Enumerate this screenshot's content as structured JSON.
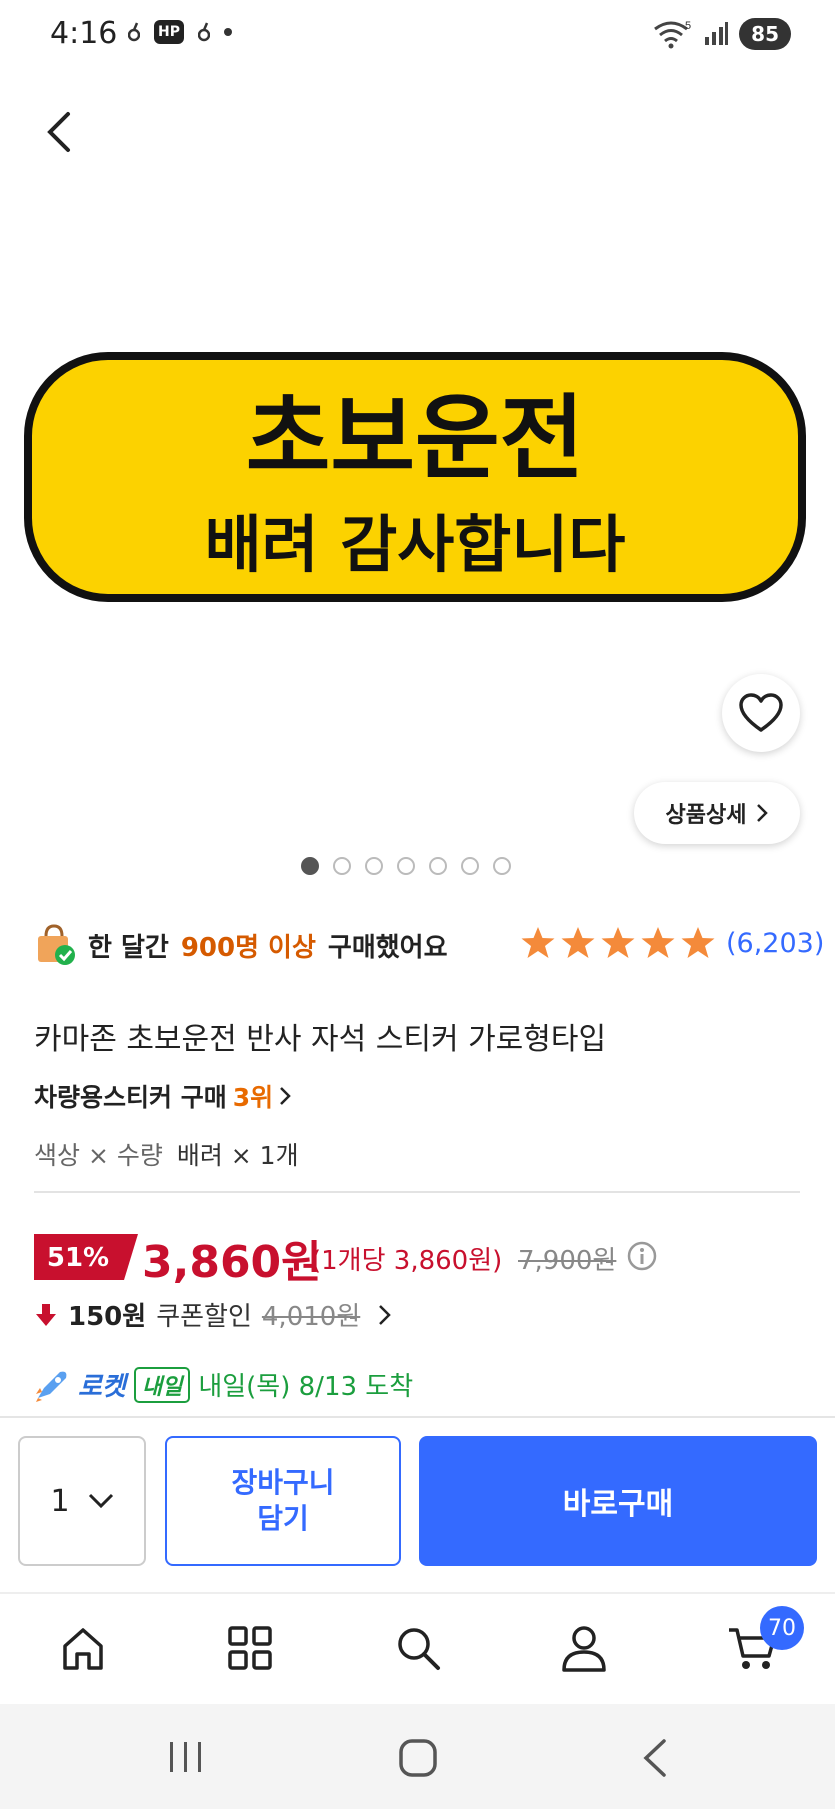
{
  "status_bar": {
    "time": "4:16",
    "hp_badge": "HP",
    "battery": "85",
    "wifi_label": "5"
  },
  "product": {
    "image_sticker_line1": "초보운전",
    "image_sticker_line2": "배려 감사합니다",
    "image_colors": {
      "fill": "#fcd200",
      "border": "#111111"
    },
    "detail_button": "상품상세",
    "image_count": 7,
    "current_image_index": 0,
    "purchase_text_prefix": "한 달간",
    "purchase_count": "900명 이상",
    "purchase_text_suffix": "구매했어요",
    "rating_stars": 5,
    "rating_count": "(6,203)",
    "title": "카마존 초보운전 반사 자석 스티커 가로형타입",
    "rank_text": "차량용스티커 구매",
    "rank_value": "3위",
    "option_label": "색상 × 수량",
    "option_value": "배려 × 1개"
  },
  "price": {
    "discount": "51%",
    "sale_price": "3,860원",
    "unit_price": "(1개당 3,860원)",
    "original_price": "7,900원",
    "coupon_amount": "150원",
    "coupon_label": "쿠폰할인",
    "pre_coupon_price": "4,010원"
  },
  "delivery": {
    "rocket_label": "로켓",
    "tomorrow_badge": "내일",
    "arrival": "내일(목) 8/13 도착"
  },
  "actions": {
    "quantity": "1",
    "cart_line1": "장바구니",
    "cart_line2": "담기",
    "buy_now": "바로구매"
  },
  "nav": {
    "items": [
      "home-icon",
      "categories-icon",
      "search-icon",
      "account-icon",
      "cart-icon"
    ],
    "cart_count": "70"
  },
  "colors": {
    "accent_blue": "#346aff",
    "price_red": "#c8102e",
    "orange": "#e86a00",
    "green": "#1b9e3e"
  }
}
